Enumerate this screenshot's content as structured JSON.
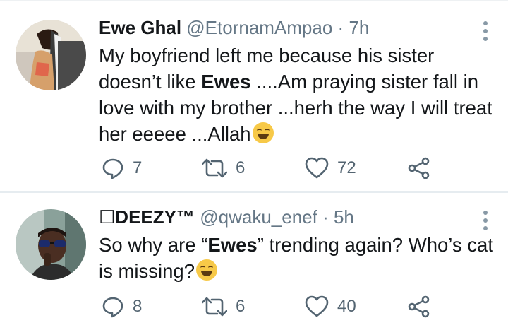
{
  "tweets": [
    {
      "name": "Ewe Ghal",
      "handle": "@EtornamAmpao",
      "time": "7h",
      "body_1": "My boyfriend left me because his sister doesn’t  like ",
      "body_bold": "Ewes",
      "body_2": "  ....Am praying sister fall in love with my brother ...herh the way I will treat her eeeee ...Allah",
      "emoji": "face-with-tears-of-joy",
      "replies": "7",
      "retweets": "6",
      "likes": "72"
    },
    {
      "name": "☐DEEZY™",
      "handle": "@qwaku_enef",
      "time": "5h",
      "body_1": "So why are “",
      "body_bold": "Ewes",
      "body_2": "” trending again? Who’s cat is missing?",
      "emoji": "grinning-cat-with-tears",
      "replies": "8",
      "retweets": "6",
      "likes": "40"
    }
  ],
  "separator": " · ",
  "colors": {
    "text": "#14171a",
    "muted": "#657786",
    "icon": "#536471",
    "divider": "#e6ecf0"
  }
}
